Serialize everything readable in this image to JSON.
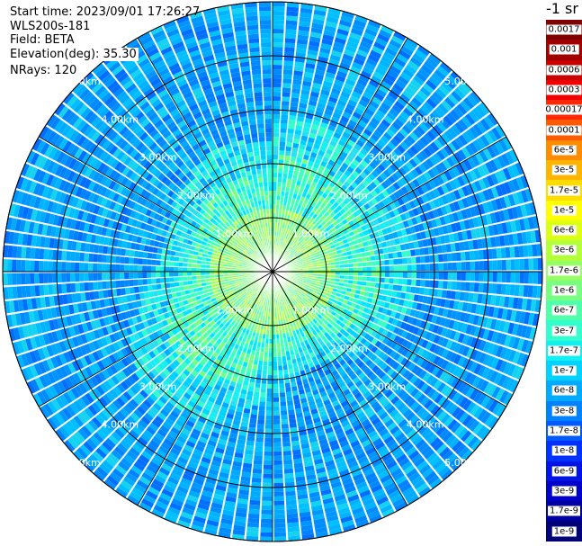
{
  "header": {
    "start_time": "Start time: 2023/09/01 17:26:27",
    "instrument": "WLS200s-181",
    "field": "Field: BETA",
    "elevation": "Elevation(deg): 35.30",
    "nrays": "NRays: 120"
  },
  "colorbar": {
    "unit_label": "-1 sr",
    "entries": [
      {
        "label": "0.0017",
        "color": "#800000"
      },
      {
        "label": "0.001",
        "color": "#a00000"
      },
      {
        "label": "0.0006",
        "color": "#c80000"
      },
      {
        "label": "0.0003",
        "color": "#f00000"
      },
      {
        "label": "0.00017",
        "color": "#ff2800"
      },
      {
        "label": "0.0001",
        "color": "#ff5a00"
      },
      {
        "label": "6e-5",
        "color": "#ff8c00"
      },
      {
        "label": "3e-5",
        "color": "#ffb400"
      },
      {
        "label": "1.7e-5",
        "color": "#ffdc00"
      },
      {
        "label": "1e-5",
        "color": "#ffff00"
      },
      {
        "label": "6e-6",
        "color": "#dcff14"
      },
      {
        "label": "3e-6",
        "color": "#b4ff3c"
      },
      {
        "label": "1.7e-6",
        "color": "#96ff64"
      },
      {
        "label": "1e-6",
        "color": "#78ff82"
      },
      {
        "label": "6e-7",
        "color": "#50ffaa"
      },
      {
        "label": "3e-7",
        "color": "#32ffcc"
      },
      {
        "label": "1.7e-7",
        "color": "#14f0f0"
      },
      {
        "label": "1e-7",
        "color": "#00d2ff"
      },
      {
        "label": "6e-8",
        "color": "#00aaff"
      },
      {
        "label": "3e-8",
        "color": "#0082ff"
      },
      {
        "label": "1.7e-8",
        "color": "#005aff"
      },
      {
        "label": "1e-8",
        "color": "#0032ff"
      },
      {
        "label": "6e-9",
        "color": "#0014e6"
      },
      {
        "label": "3e-9",
        "color": "#0000c8"
      },
      {
        "label": "1.7e-9",
        "color": "#0000a0"
      },
      {
        "label": "1e-9",
        "color": "#000078"
      }
    ]
  },
  "range_rings": [
    {
      "label": "1.00km",
      "km": 1
    },
    {
      "label": "2.00km",
      "km": 2
    },
    {
      "label": "3.00km",
      "km": 3
    },
    {
      "label": "4.00km",
      "km": 4
    },
    {
      "label": "5.00km",
      "km": 5
    }
  ],
  "max_range_km": 5
}
